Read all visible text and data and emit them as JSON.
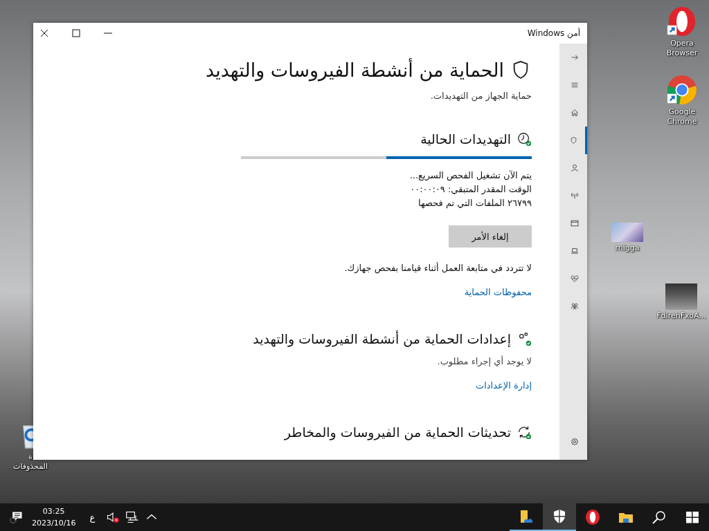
{
  "desktop": {
    "icons": [
      {
        "kind": "opera",
        "lines": [
          "Opera",
          "Browser"
        ]
      },
      {
        "kind": "chrome",
        "lines": [
          "Google",
          "Chrome"
        ]
      },
      {
        "kind": "thumb_a",
        "lines": [
          "rnigga"
        ]
      },
      {
        "kind": "thumb_b",
        "lines": [
          "FdlrehFxoA..."
        ]
      },
      {
        "kind": "recycle",
        "lines": [
          "ة",
          "المحذوفات"
        ]
      }
    ]
  },
  "window": {
    "title": "أمن Windows"
  },
  "nav": [
    {
      "kind": "back",
      "selected": false
    },
    {
      "kind": "menu",
      "selected": false
    },
    {
      "kind": "home",
      "selected": false
    },
    {
      "kind": "shield",
      "selected": true
    },
    {
      "kind": "person",
      "selected": false
    },
    {
      "kind": "antenna",
      "selected": false
    },
    {
      "kind": "browser",
      "selected": false
    },
    {
      "kind": "laptop",
      "selected": false
    },
    {
      "kind": "heart",
      "selected": false
    },
    {
      "kind": "family",
      "selected": false
    },
    {
      "kind": "settings",
      "selected": false
    }
  ],
  "page": {
    "title": "الحماية من أنشطة الفيروسات والتهديد",
    "subtitle": "حماية الجهاز من التهديدات."
  },
  "scan": {
    "heading": "التهديدات الحالية",
    "level": 0.5,
    "lines": [
      "يتم الآن تشغيل الفحص السريع...",
      "الوقت المقدر المتبقي: ٠٠:٠٠:٠٩",
      "٢٦٧٩٩ الملفات التي تم فحصها"
    ],
    "button": "إلغاء الأمر",
    "note": "لا تتردد في متابعة العمل أثناء قيامنا بفحص جهازك.",
    "link": "محفوظات الحماية"
  },
  "sections": [
    {
      "kind": "settings",
      "heading": "إعدادات الحماية من أنشطة الفيروسات والتهديد",
      "status": "لا يوجد أي إجراء مطلوب.",
      "link": "إدارة الإعدادات"
    },
    {
      "kind": "updates",
      "heading": "تحديثات الحماية من الفيروسات والمخاطر"
    }
  ],
  "taskbar": {
    "apps": [
      {
        "kind": "start",
        "open": false,
        "selected": false
      },
      {
        "kind": "search",
        "open": false,
        "selected": false
      },
      {
        "kind": "explorer",
        "open": false,
        "selected": false
      },
      {
        "kind": "opera",
        "open": false,
        "selected": false
      },
      {
        "kind": "defender",
        "open": true,
        "selected": true
      },
      {
        "kind": "onedrive",
        "open": true,
        "selected": false
      }
    ],
    "language": "ع",
    "time": "03:25",
    "date": "2023/10/16"
  }
}
